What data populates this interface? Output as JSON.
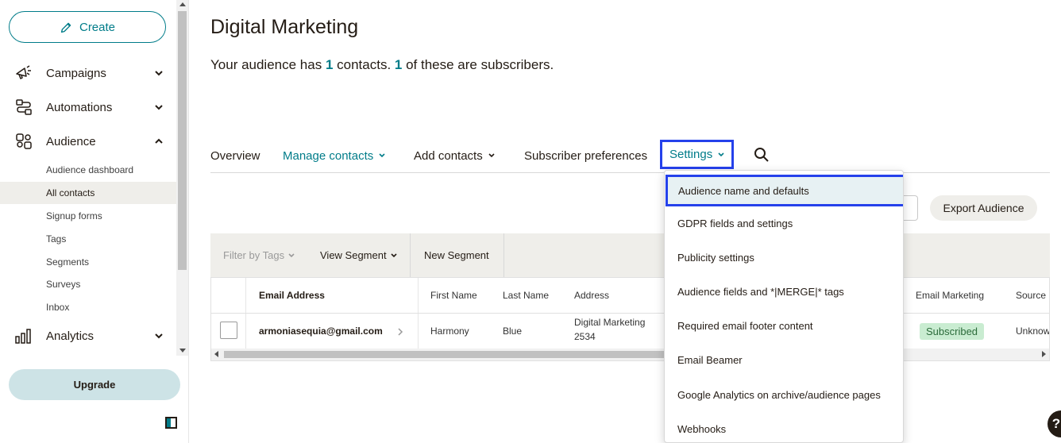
{
  "sidebar": {
    "create_label": "Create",
    "nav": [
      {
        "label": "Campaigns",
        "icon": "megaphone-icon"
      },
      {
        "label": "Automations",
        "icon": "automation-icon"
      },
      {
        "label": "Audience",
        "icon": "audience-icon"
      },
      {
        "label": "Analytics",
        "icon": "bar-chart-icon"
      }
    ],
    "audience_sub": [
      {
        "label": "Audience dashboard"
      },
      {
        "label": "All contacts",
        "active": true
      },
      {
        "label": "Signup forms"
      },
      {
        "label": "Tags"
      },
      {
        "label": "Segments"
      },
      {
        "label": "Surveys"
      },
      {
        "label": "Inbox"
      }
    ],
    "upgrade_label": "Upgrade"
  },
  "main": {
    "title": "Digital Marketing",
    "summary": {
      "part1": "Your audience has ",
      "contacts": "1",
      "part2": " contacts. ",
      "subscribers": "1",
      "part3": " of these are subscribers."
    },
    "tabs": [
      {
        "label": "Overview"
      },
      {
        "label": "Manage contacts"
      },
      {
        "label": "Add contacts"
      },
      {
        "label": "Subscriber preferences"
      },
      {
        "label": "Settings"
      }
    ],
    "export_label": "Export Audience"
  },
  "toolbar": {
    "filter_label": "Filter by Tags",
    "view_segment_label": "View Segment",
    "new_segment_label": "New Segment"
  },
  "table": {
    "headers": [
      "Email Address",
      "First Name",
      "Last Name",
      "Address",
      "Email Marketing",
      "Source"
    ],
    "row": {
      "email": "armoniasequia@gmail.com",
      "first_name": "Harmony",
      "last_name": "Blue",
      "address_line1": "Digital Marketing",
      "address_line2": "2534",
      "email_marketing": "Subscribed",
      "source": "Unknow"
    }
  },
  "settings_menu": [
    "Audience name and defaults",
    "GDPR fields and settings",
    "Publicity settings",
    "Audience fields and *|MERGE|* tags",
    "Required email footer content",
    "Email Beamer",
    "Google Analytics on archive/audience pages",
    "Webhooks"
  ],
  "help_label": "?",
  "colors": {
    "accent": "#007c89",
    "highlight_border": "#2541eb",
    "subscribed_bg": "#c9ecd1"
  }
}
